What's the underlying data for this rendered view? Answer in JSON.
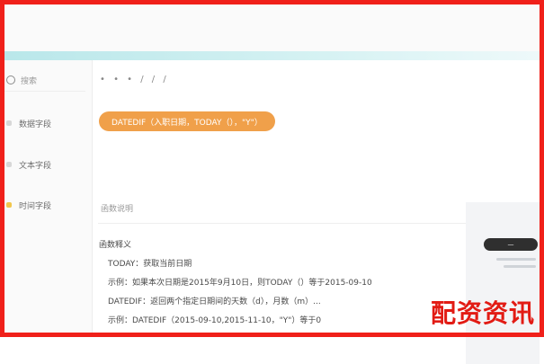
{
  "breadcrumb": "• • • / / /",
  "sidebar": {
    "search_placeholder": "搜索",
    "items": [
      {
        "label": "数据字段"
      },
      {
        "label": "文本字段"
      },
      {
        "label": "时间字段"
      }
    ]
  },
  "formula_chip": {
    "text": "DATEDIF（入职日期，TODAY（），\"Y\"）"
  },
  "section": {
    "title": "函数说明"
  },
  "syntax": {
    "label": "函数释义",
    "lines": [
      "TODAY：获取当前日期",
      "示例：如果本次日期是2015年9月10日，则TODAY（）等于2015-09-10",
      "DATEDIF：返回两个指定日期间的天数（d），月数（m）...",
      "示例：DATEDIF（2015-09-10,2015-11-10，\"Y\"）等于0"
    ]
  },
  "right_panel": {
    "chip_text": "—"
  },
  "watermark": "配资资讯",
  "colors": {
    "frame": "#f0201a",
    "accent": "#f0a04a",
    "teal": "#bfe8ea"
  }
}
